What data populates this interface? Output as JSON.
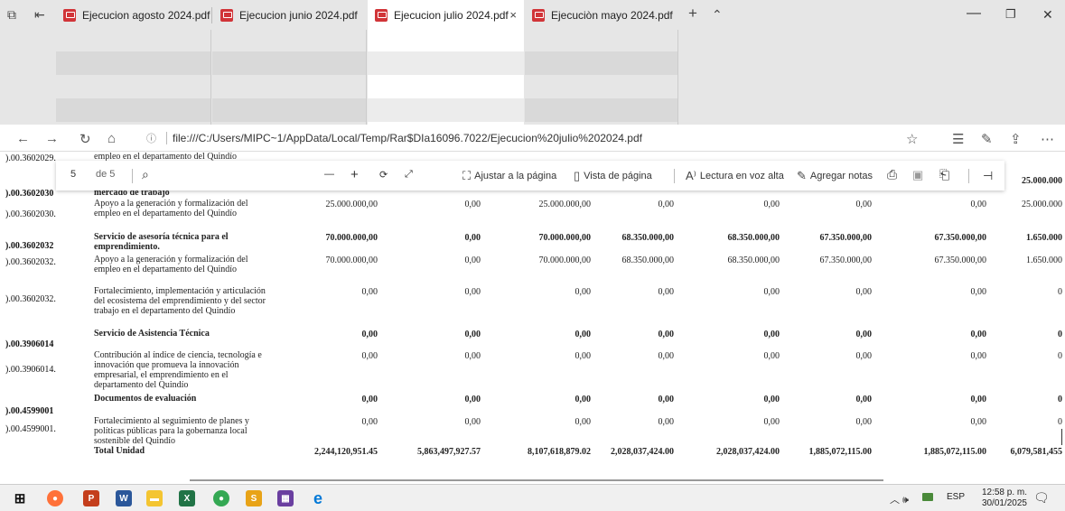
{
  "tabs": [
    {
      "label": "Ejecucion agosto 2024.pdf"
    },
    {
      "label": "Ejecucion junio 2024.pdf"
    },
    {
      "label": "Ejecucion julio 2024.pdf"
    },
    {
      "label": "Ejecuciòn mayo 2024.pdf"
    }
  ],
  "tab_close": "×",
  "new_tab": "+",
  "tab_list": "⌃",
  "window": {
    "minimize": "—",
    "restore": "❐",
    "close": "✕"
  },
  "address": {
    "url": "file:///C:/Users/MIPC~1/AppData/Local/Temp/Rar$DIa16096.7022/Ejecucion%20julio%202024.pdf"
  },
  "pdf_toolbar": {
    "page": "5",
    "of": "de 5",
    "search_icon": "⌕",
    "zoom_out": "—",
    "zoom_in": "+",
    "rotate": "⟳",
    "fullscreen": "⤢",
    "fit": "Ajustar a la página",
    "page_view": "Vista de página",
    "read_aloud": "Lectura en voz alta",
    "add_notes": "Agregar notas",
    "print_icon": "⎙",
    "save_icon": "▣",
    "saveas_icon": "⎗",
    "pin_icon": "⊣"
  },
  "rows": [
    {
      "code": ").00.3602029.",
      "desc": "empleo en el departamento del Quindío",
      "bold": false,
      "vals": [
        "",
        "",
        "",
        "",
        "",
        "",
        "",
        ""
      ]
    },
    {
      "code": "",
      "desc": "",
      "bold": false,
      "vals": [
        "",
        "",
        "",
        "",
        "",
        "",
        "",
        "25.000.000"
      ]
    },
    {
      "code": ").00.3602030",
      "desc": "mercado de trabajo",
      "bold": true,
      "vals": [
        "",
        "",
        "",
        "",
        "",
        "",
        "",
        ""
      ]
    },
    {
      "code": ").00.3602030.",
      "desc": "Apoyo a la generación y formalización del empleo en el departamento del Quindío",
      "bold": false,
      "vals": [
        "25.000.000,00",
        "0,00",
        "25.000.000,00",
        "0,00",
        "0,00",
        "0,00",
        "0,00",
        "25.000.000"
      ]
    },
    {
      "code": ").00.3602032",
      "desc": "Servicio de asesoría técnica para el emprendimiento.",
      "bold": true,
      "vals": [
        "70.000.000,00",
        "0,00",
        "70.000.000,00",
        "68.350.000,00",
        "68.350.000,00",
        "67.350.000,00",
        "67.350.000,00",
        "1.650.000"
      ]
    },
    {
      "code": ").00.3602032.",
      "desc": "Apoyo a la generación y formalización del empleo en el departamento del Quindío",
      "bold": false,
      "vals": [
        "70.000.000,00",
        "0,00",
        "70.000.000,00",
        "68.350.000,00",
        "68.350.000,00",
        "67.350.000,00",
        "67.350.000,00",
        "1.650.000"
      ]
    },
    {
      "code": ").00.3602032.",
      "desc": "Fortalecimiento, implementación y articulación del ecosistema del emprendimiento y del sector trabajo en el departamento del Quindío",
      "bold": false,
      "vals": [
        "0,00",
        "0,00",
        "0,00",
        "0,00",
        "0,00",
        "0,00",
        "0,00",
        "0"
      ]
    },
    {
      "code": ").00.3906014",
      "desc": "Servicio de Asistencia Técnica",
      "bold": true,
      "vals": [
        "0,00",
        "0,00",
        "0,00",
        "0,00",
        "0,00",
        "0,00",
        "0,00",
        "0"
      ]
    },
    {
      "code": ").00.3906014.",
      "desc": "Contribución al índice de ciencia, tecnología e innovación que promueva la innovación empresarial, el emprendimiento en el departamento del Quindío",
      "bold": false,
      "vals": [
        "0,00",
        "0,00",
        "0,00",
        "0,00",
        "0,00",
        "0,00",
        "0,00",
        "0"
      ]
    },
    {
      "code": ").00.4599001",
      "desc": "Documentos de evaluación",
      "bold": true,
      "vals": [
        "0,00",
        "0,00",
        "0,00",
        "0,00",
        "0,00",
        "0,00",
        "0,00",
        "0"
      ]
    },
    {
      "code": ").00.4599001.",
      "desc": "Fortalecimiento al seguimiento de planes y políticas públicas para la gobernanza local sostenible del Quindío",
      "bold": false,
      "vals": [
        "0,00",
        "0,00",
        "0,00",
        "0,00",
        "0,00",
        "0,00",
        "0,00",
        "0"
      ]
    },
    {
      "code": "",
      "desc": "Total Unidad",
      "bold": true,
      "vals": [
        "2,244,120,951.45",
        "5,863,497,927.57",
        "8,107,618,879.02",
        "2,028,037,424.00",
        "2,028,037,424.00",
        "1,885,072,115.00",
        "1,885,072,115.00",
        "6,079,581,455"
      ]
    }
  ],
  "taskbar": {
    "apps": [
      {
        "name": "windows-start",
        "label": "⊞",
        "color": "#1e1e1e"
      },
      {
        "name": "firefox",
        "label": "●",
        "color": "#ff7139"
      },
      {
        "name": "powerpoint",
        "label": "P",
        "color": "#c43e1c"
      },
      {
        "name": "word",
        "label": "W",
        "color": "#2b579a"
      },
      {
        "name": "file-explorer",
        "label": "▬",
        "color": "#f4c531"
      },
      {
        "name": "excel",
        "label": "X",
        "color": "#217346"
      },
      {
        "name": "chrome",
        "label": "●",
        "color": "#34a853"
      },
      {
        "name": "app-s",
        "label": "S",
        "color": "#e8a317"
      },
      {
        "name": "app-colorful",
        "label": "▦",
        "color": "#6a3fa0"
      },
      {
        "name": "edge",
        "label": "e",
        "color": "#0078d7"
      }
    ],
    "lang": "ESP",
    "time": "12:58 p. m.",
    "date": "30/01/2025",
    "tray": "︿ 🕪"
  }
}
